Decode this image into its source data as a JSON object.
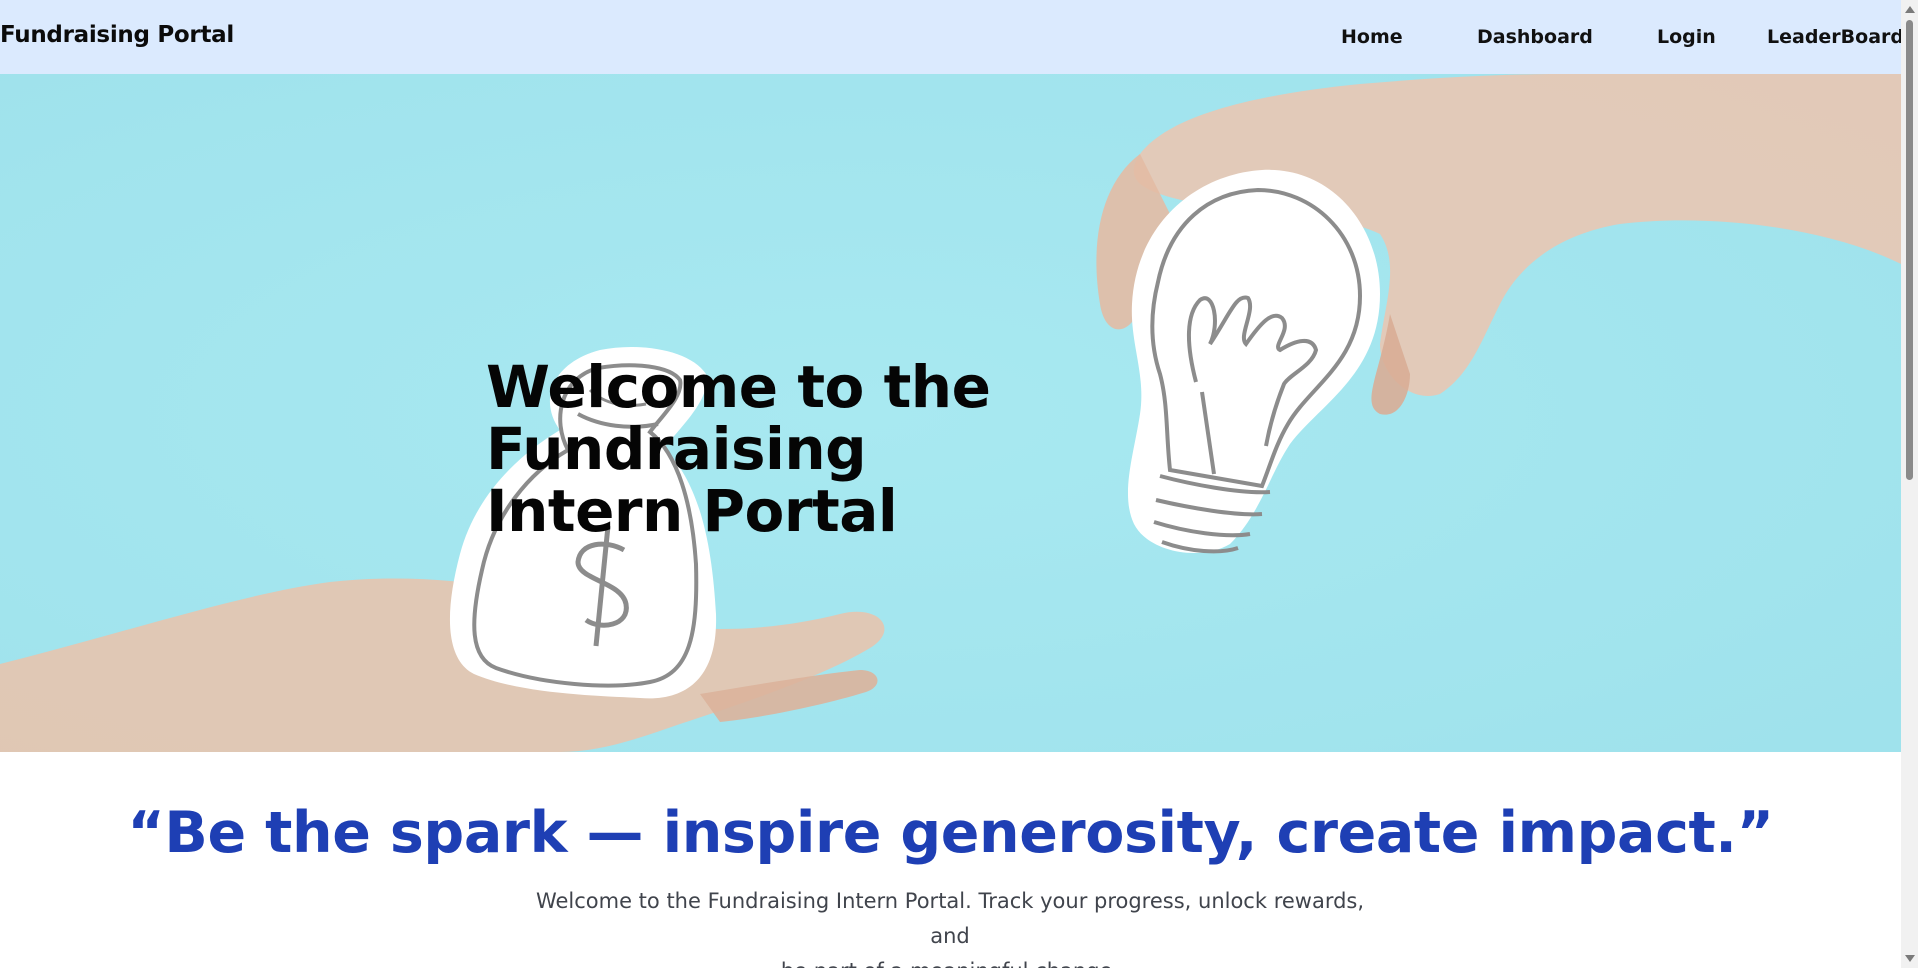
{
  "navbar": {
    "brand": "Fundraising Portal",
    "links": [
      {
        "label": "Home"
      },
      {
        "label": "Dashboard"
      },
      {
        "label": "Login"
      },
      {
        "label": "LeaderBoard"
      }
    ]
  },
  "hero": {
    "title_line1": "Welcome to the Fundraising",
    "title_line2": "Intern Portal",
    "image_elements": [
      "money-bag-icon",
      "lightbulb-icon",
      "hand-icon"
    ]
  },
  "quote": {
    "text": "“Be the spark — inspire generosity, create impact.”",
    "line1": "Welcome to the Fundraising Intern Portal. Track your progress, unlock rewards, and",
    "line2": "be part of a meaningful change."
  },
  "colors": {
    "navbar_bg": "#dbeafe",
    "hero_bg": "#a4e6ef",
    "quote_color": "#1e3fb4",
    "subtext_color": "#40444c"
  }
}
